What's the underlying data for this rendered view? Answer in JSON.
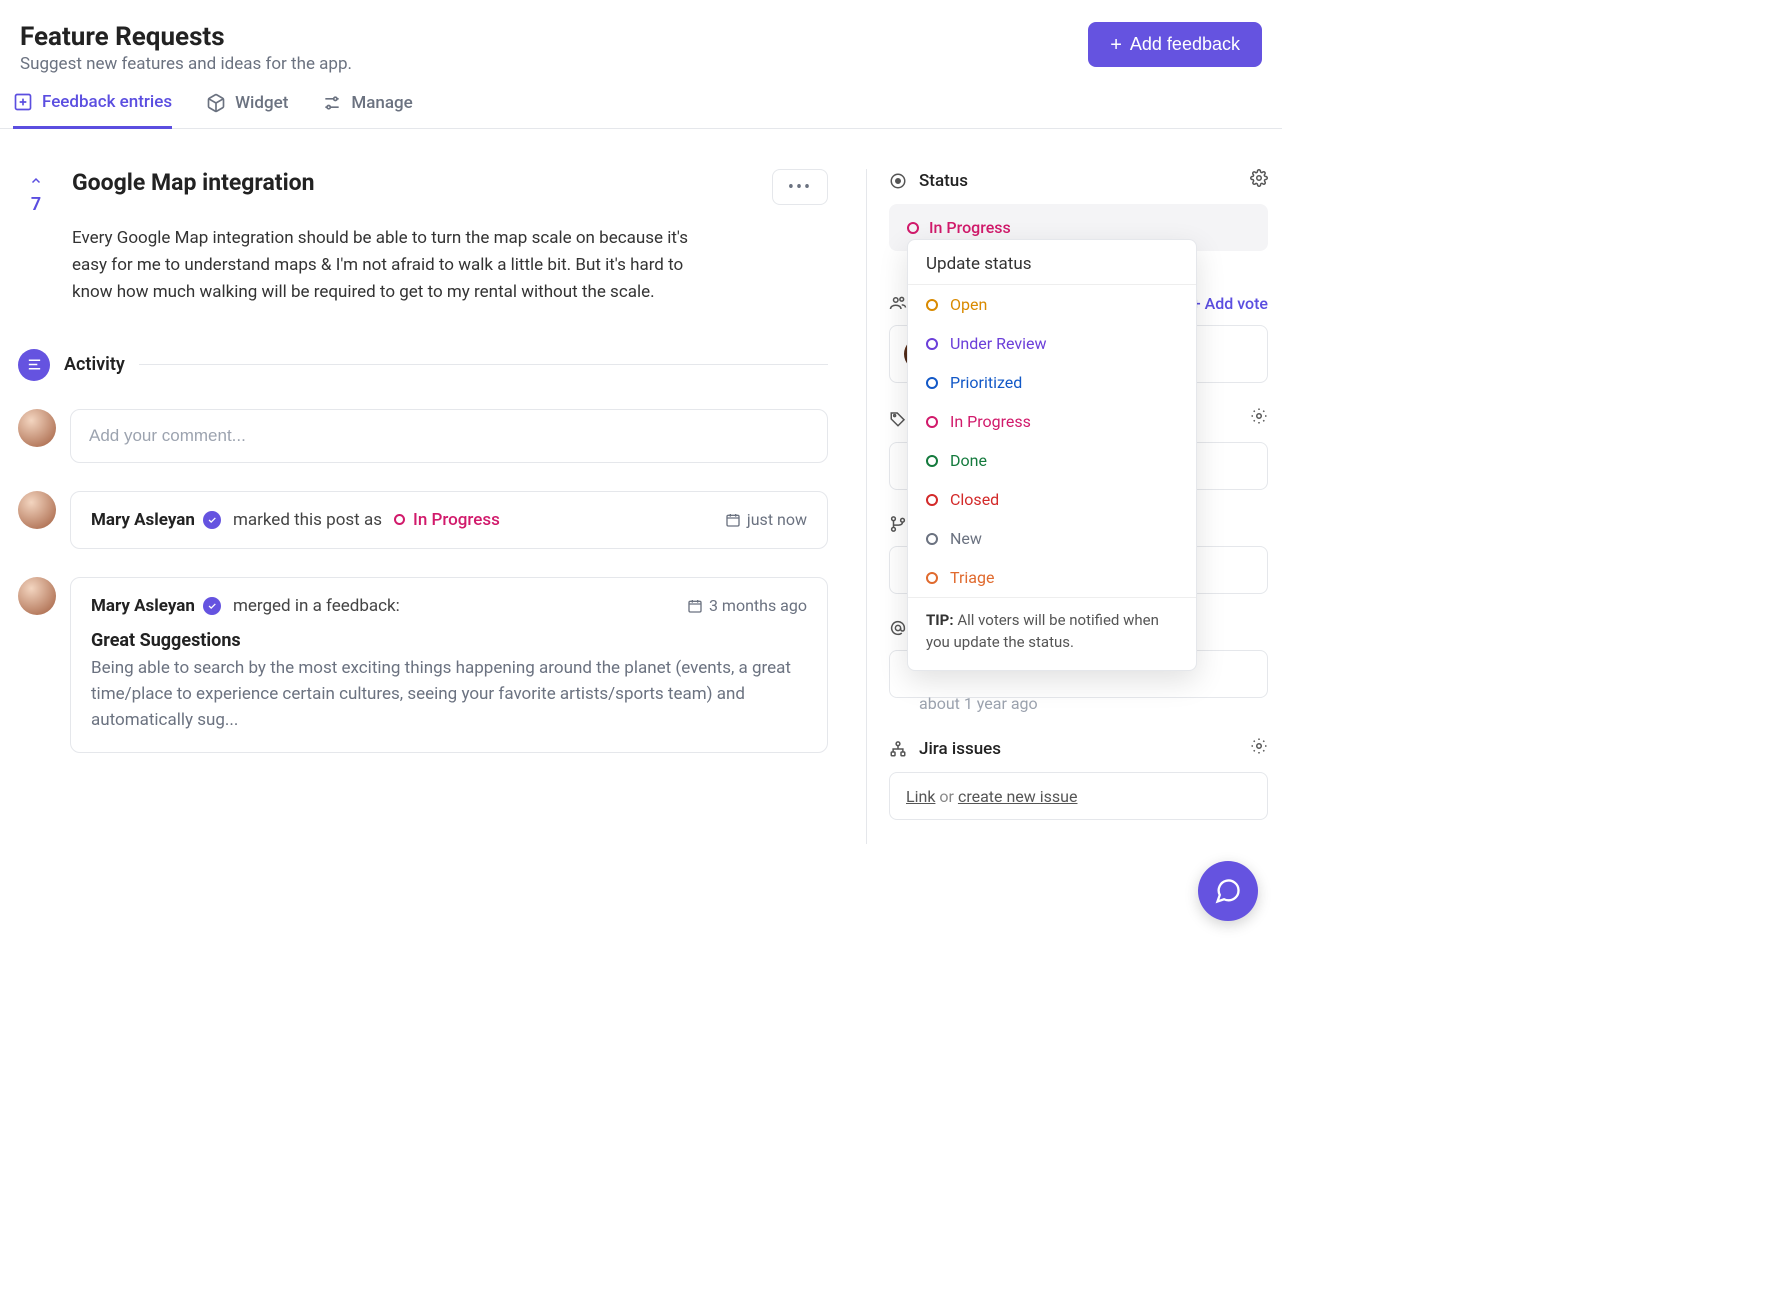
{
  "colors": {
    "accent": "#6553e0",
    "status_in_progress": "#d11a6b"
  },
  "header": {
    "title": "Feature Requests",
    "subtitle": "Suggest new features and ideas for the app.",
    "add_feedback_label": "Add feedback"
  },
  "tabs": {
    "feedback_entries": "Feedback entries",
    "widget": "Widget",
    "manage": "Manage"
  },
  "post": {
    "votes": "7",
    "title": "Google Map integration",
    "body": "Every Google Map integration should be able to turn the map scale on because it's easy for me to understand maps & I'm not afraid to walk a little bit. But it's hard to know how much walking will be required to get to my rental without the scale."
  },
  "activity": {
    "label": "Activity",
    "comment_placeholder": "Add your comment..."
  },
  "events": {
    "status_change": {
      "user": "Mary Asleyan",
      "action": "marked this post as",
      "status": "In Progress",
      "time": "just now"
    },
    "merge": {
      "user": "Mary Asleyan",
      "action": "merged in a feedback:",
      "time": "3 months ago",
      "merged_title": "Great Suggestions",
      "merged_body": "Being able to search by the most exciting things happening around the planet (events, a great time/place to experience certain cultures, seeing your favorite artists/sports team) and automatically sug..."
    }
  },
  "sidebar": {
    "status_label": "Status",
    "status_value": "In Progress",
    "voters_label": "Voters",
    "add_vote_label": "+ Add vote",
    "tags_label": "Tags",
    "github_label": "GitHub",
    "mentions_label": "Mentions",
    "timestamp": "about 1 year ago",
    "jira_label": "Jira issues",
    "jira_link": "Link",
    "jira_or": "or",
    "jira_create": "create new issue"
  },
  "status_dropdown": {
    "heading": "Update status",
    "options": [
      {
        "label": "Open",
        "color": "#d98a00"
      },
      {
        "label": "Under Review",
        "color": "#6b3fd9"
      },
      {
        "label": "Prioritized",
        "color": "#1258c7"
      },
      {
        "label": "In Progress",
        "color": "#d11a6b"
      },
      {
        "label": "Done",
        "color": "#147a3d"
      },
      {
        "label": "Closed",
        "color": "#d32a2a"
      },
      {
        "label": "New",
        "color": "#6b7280"
      },
      {
        "label": "Triage",
        "color": "#e06a2e"
      }
    ],
    "tip_label": "TIP:",
    "tip_text": "All voters will be notified when you update the status."
  }
}
